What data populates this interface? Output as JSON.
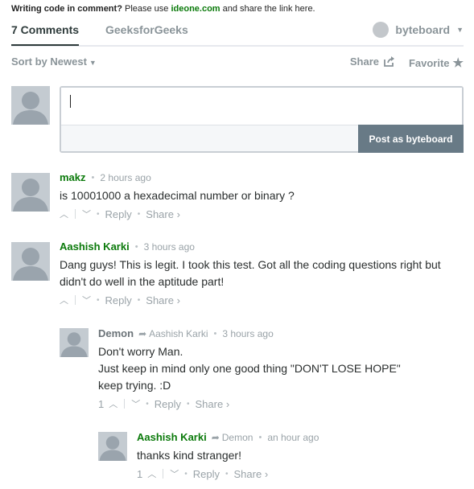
{
  "notice": {
    "lead": "Writing code in comment?",
    "pre": " Please use ",
    "link": "ideone.com",
    "post": " and share the link here."
  },
  "tabs": {
    "comments": "7 Comments",
    "site": "GeeksforGeeks",
    "user": "byteboard"
  },
  "sortbar": {
    "sort": "Sort by Newest",
    "share": "Share",
    "favorite": "Favorite"
  },
  "compose": {
    "placeholder": "",
    "post_button": "Post as byteboard"
  },
  "comments": [
    {
      "author": "makz",
      "time": "2 hours ago",
      "lines": [
        "is 10001000 a hexadecimal number or binary ?"
      ],
      "reply": "Reply",
      "share": "Share ›"
    },
    {
      "author": "Aashish Karki",
      "time": "3 hours ago",
      "lines": [
        "Dang guys! This is legit. I took this test. Got all the coding questions right but",
        "didn't do well in the aptitude part!"
      ],
      "reply": "Reply",
      "share": "Share ›"
    },
    {
      "author": "Demon",
      "reply_to": "Aashish Karki",
      "time": "3 hours ago",
      "lines": [
        "Don't worry Man.",
        "Just keep in mind only one good thing \"DON'T LOSE HOPE\"",
        "keep trying. :D"
      ],
      "votes": "1",
      "reply": "Reply",
      "share": "Share ›"
    },
    {
      "author": "Aashish Karki",
      "reply_to": "Demon",
      "time": "an hour ago",
      "lines": [
        "thanks kind stranger!"
      ],
      "votes": "1",
      "reply": "Reply",
      "share": "Share ›"
    }
  ],
  "icons": {
    "upvote": "chevron-up-icon",
    "downvote": "chevron-down-icon",
    "share": "share-export-icon",
    "favorite": "star-icon",
    "reply_to": "reply-arrow-icon"
  },
  "colors": {
    "author_green": "#0b7a0b",
    "post_button": "#687a86",
    "avatar": "#c4cbd1"
  }
}
